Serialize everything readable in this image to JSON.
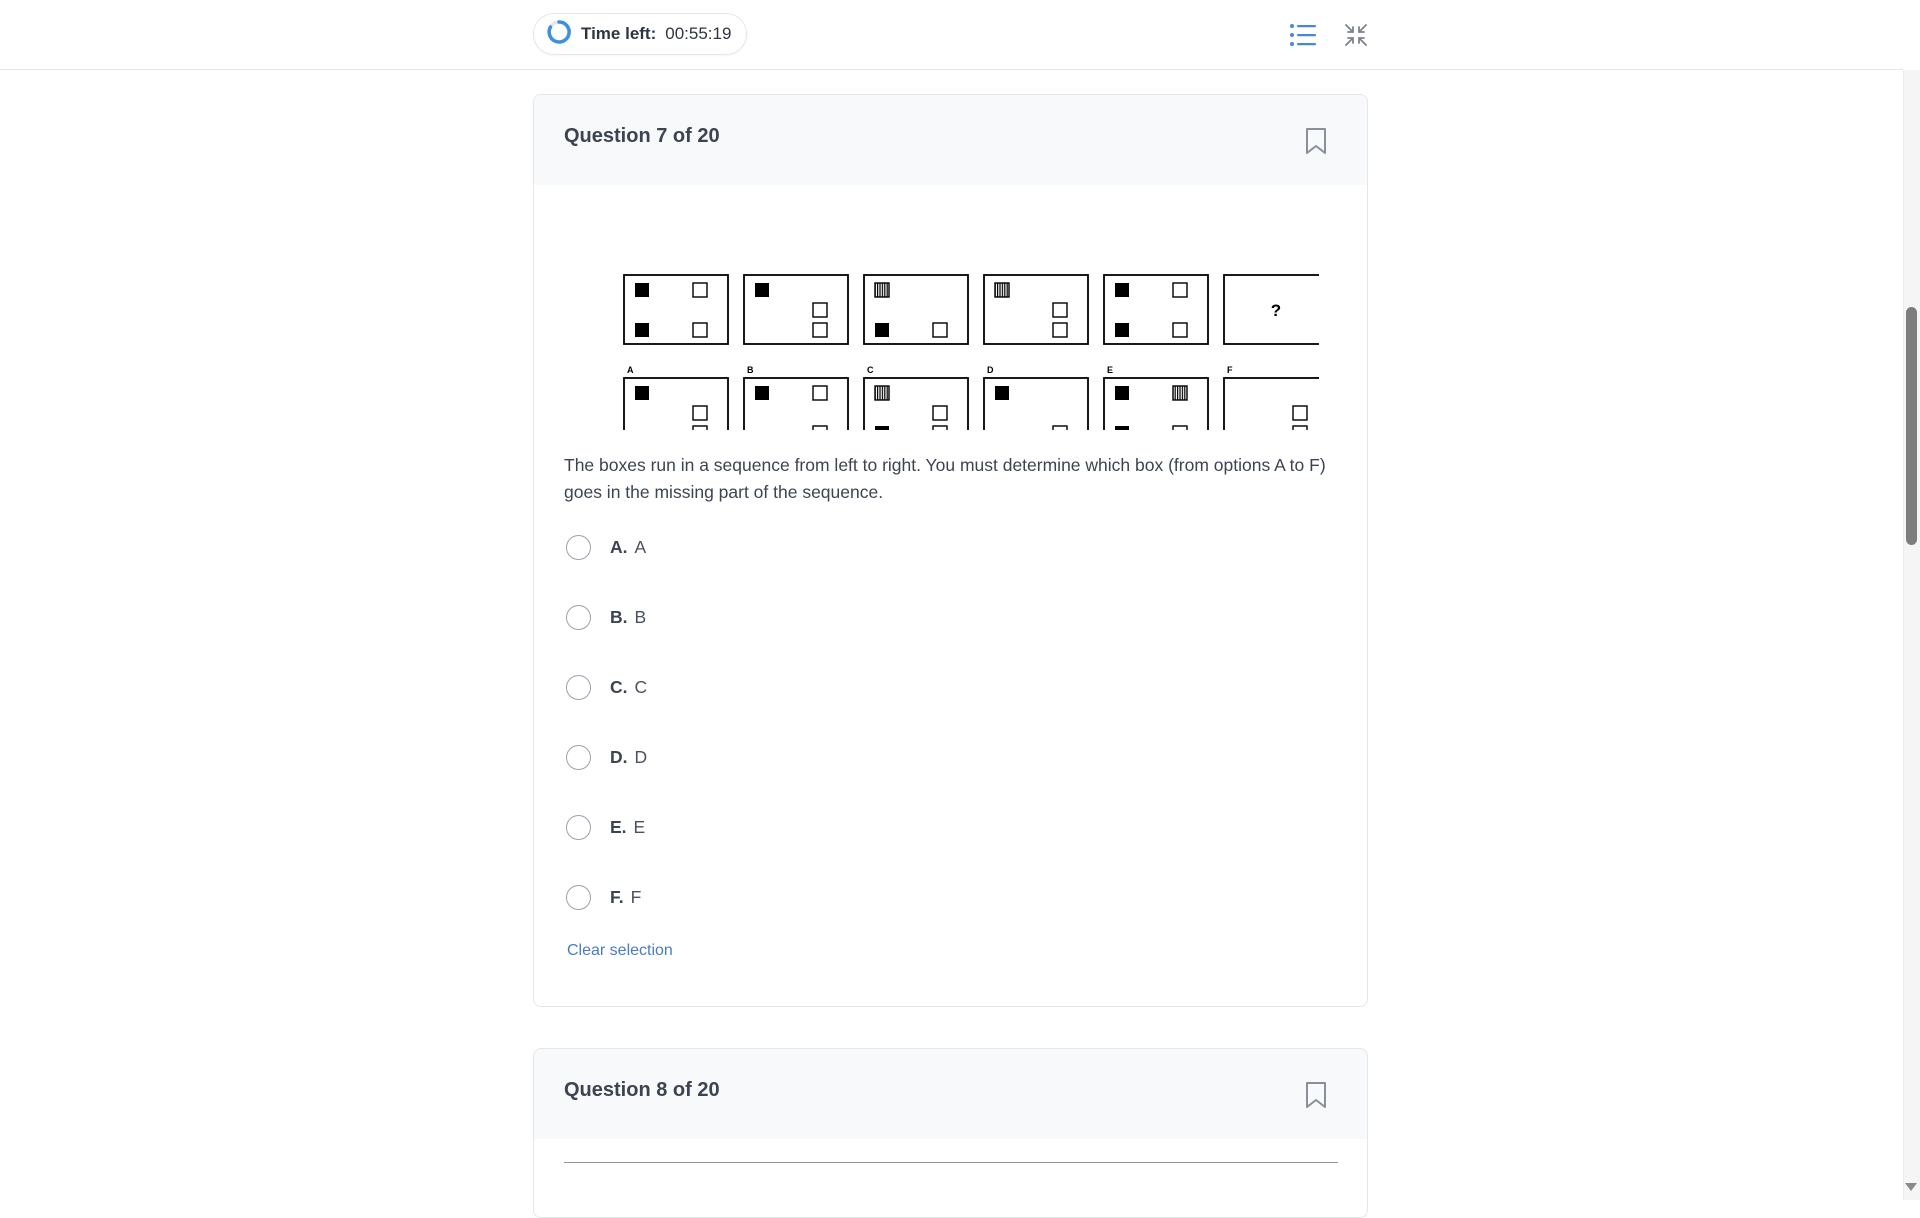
{
  "timer": {
    "label": "Time left:",
    "value": "00:55:19"
  },
  "icons": {
    "timer": "spinner-icon",
    "list": "list-icon",
    "collapse": "collapse-icon",
    "bookmark": "bookmark-icon"
  },
  "question7": {
    "title": "Question 7 of 20",
    "puzzle": {
      "sequence_cells": [
        "",
        "",
        "",
        "",
        "",
        "?"
      ],
      "option_labels": [
        "A",
        "B",
        "C",
        "D",
        "E",
        "F"
      ]
    },
    "text": "The boxes run in a sequence from left to right. You must determine which box (from options A to F) goes in the missing part of the sequence.",
    "options": [
      {
        "letter": "A.",
        "text": "A"
      },
      {
        "letter": "B.",
        "text": "B"
      },
      {
        "letter": "C.",
        "text": "C"
      },
      {
        "letter": "D.",
        "text": "D"
      },
      {
        "letter": "E.",
        "text": "E"
      },
      {
        "letter": "F.",
        "text": "F"
      }
    ],
    "clear_label": "Clear selection"
  },
  "question8": {
    "title": "Question 8 of 20"
  },
  "colors": {
    "accent": "#4a86d8",
    "link": "#4a7cc4",
    "text": "#3d4451",
    "card_header": "#f8f9fa"
  }
}
